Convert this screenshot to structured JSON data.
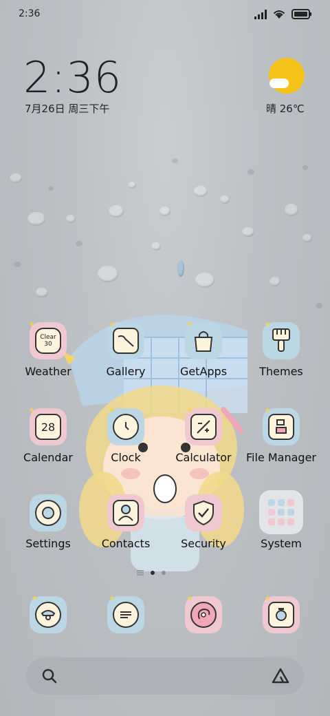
{
  "status_bar": {
    "time": "2:36"
  },
  "clock": {
    "time": "2:36",
    "date": "7月26日 周三下午"
  },
  "weather_widget": {
    "text": "晴 26℃"
  },
  "weather_icon_text": "Clear 30",
  "calendar_icon_number": "28",
  "apps": {
    "weather": "Weather",
    "gallery": "Gallery",
    "getapps": "GetApps",
    "themes": "Themes",
    "calendar": "Calendar",
    "clock": "Clock",
    "calculator": "Calculator",
    "file_manager": "File Manager",
    "settings": "Settings",
    "contacts": "Contacts",
    "security": "Security",
    "system": "System"
  },
  "dock": [
    "phone-icon",
    "messages-icon",
    "browser-icon",
    "camera-icon"
  ],
  "icons": {
    "search": "search-icon",
    "assistant": "assistant-icon"
  },
  "colors": {
    "tile_pink": "#f0c8d0",
    "tile_blue": "#bcd6e4",
    "sun": "#f6c419"
  }
}
